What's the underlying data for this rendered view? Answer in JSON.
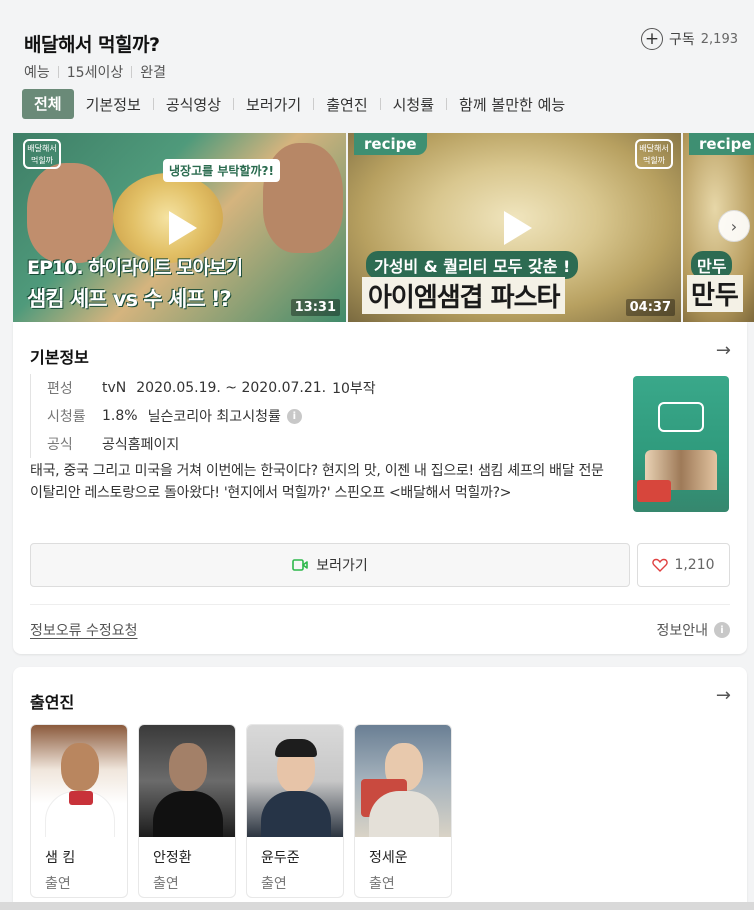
{
  "header": {
    "title": "배달해서 먹힐까?",
    "subscribe_label": "구독",
    "subscribe_count": "2,193",
    "meta": [
      "예능",
      "15세이상",
      "완결"
    ]
  },
  "tabs": [
    "전체",
    "기본정보",
    "공식영상",
    "보러가기",
    "출연진",
    "시청률",
    "함께 볼만한 예능"
  ],
  "videos": [
    {
      "top_banner": "냉장고를 부탁할까?!",
      "caption_line1": "EP10. 하이라이트 모아보기",
      "caption_line2": "샘킴 셰프 vs 수 셰프 !?",
      "duration": "13:31"
    },
    {
      "tag": "recipe",
      "caption_line1": "가성비 & 퀄리티 모두 갖춘 !",
      "caption_line2": "아이엠샘겹 파스타",
      "duration": "04:37"
    },
    {
      "tag": "recipe",
      "caption_line1": "만두",
      "caption_line2": "만두"
    }
  ],
  "info": {
    "section_title": "기본정보",
    "schedule_label": "편성",
    "channel": "tvN",
    "dates": "2020.05.19. ~ 2020.07.21.",
    "episodes": "10부작",
    "rating_label": "시청률",
    "rating_value": "1.8%",
    "rating_desc": "닐슨코리아 최고시청률",
    "official_label": "공식",
    "official_link": "공식홈페이지",
    "description": "태국, 중국 그리고 미국을 거쳐 이번에는 한국이다? 현지의 맛, 이젠 내 집으로! 샘킴 셰프의 배달 전문 이탈리안 레스토랑으로 돌아왔다! '현지에서 먹힐까?' 스핀오프 <배달해서 먹힐까?>",
    "watch_label": "보러가기",
    "like_count": "1,210",
    "report_label": "정보오류 수정요청",
    "guide_label": "정보안내"
  },
  "cast": {
    "section_title": "출연진",
    "members": [
      {
        "name": "샘 킴",
        "role": "출연"
      },
      {
        "name": "안정환",
        "role": "출연"
      },
      {
        "name": "윤두준",
        "role": "출연"
      },
      {
        "name": "정세운",
        "role": "출연"
      }
    ]
  },
  "colors": {
    "active_tab": "#6a8a78",
    "link_blue": "#2c5fb8",
    "episodes_green": "#2d9d3d",
    "rating_red": "#e04040",
    "watch_icon_green": "#2db84b",
    "heart_red": "#e04040"
  },
  "icons": [
    "plus-circle-icon",
    "play-icon",
    "chevron-right-icon",
    "arrow-right-icon",
    "info-icon",
    "video-camera-icon",
    "heart-icon"
  ]
}
